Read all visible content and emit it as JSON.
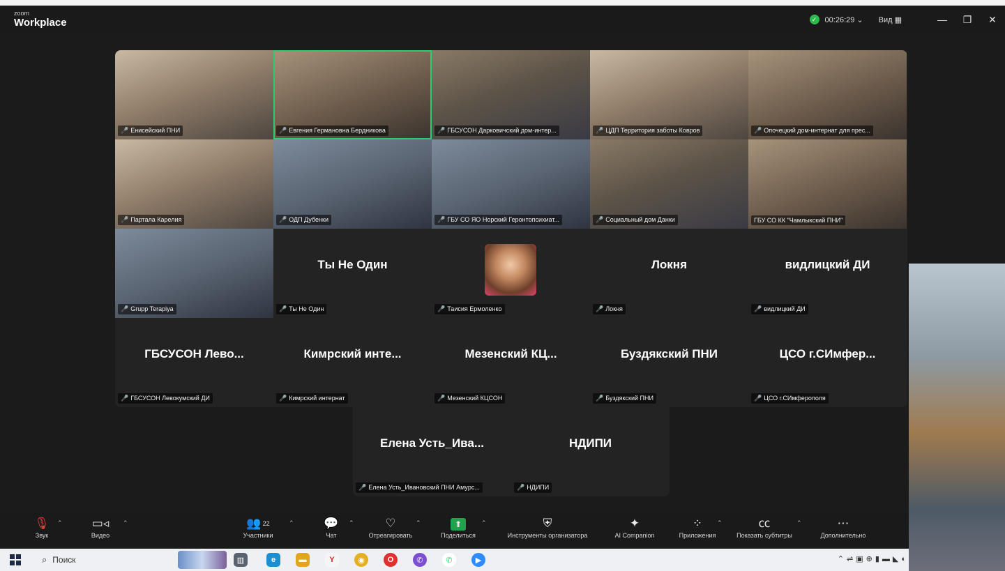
{
  "app": {
    "brand_small": "zoom",
    "brand_big": "Workplace"
  },
  "titlebar": {
    "timer": "00:26:29 ⌄",
    "view_label": "Вид ▦",
    "minimize": "—",
    "restore": "❐",
    "close": "✕"
  },
  "tiles": [
    {
      "label": "Енисейский ПНИ",
      "kind": "video"
    },
    {
      "label": "Евгения Германовна Бердникова",
      "kind": "video",
      "active": true
    },
    {
      "label": "ГБСУСОН Дарковичский дом-интер...",
      "kind": "video"
    },
    {
      "label": "ЦДП Территория заботы Ковров",
      "kind": "video"
    },
    {
      "label": "Опочецкий дом-интернат для прес...",
      "kind": "video"
    },
    {
      "label": "Партала Карелия",
      "kind": "video"
    },
    {
      "label": "ОДП Дубенки",
      "kind": "video"
    },
    {
      "label": "ГБУ СО ЯО Норский Геронтопсихиат...",
      "kind": "video"
    },
    {
      "label": "Социальный дом Данки",
      "kind": "video"
    },
    {
      "label": "ГБУ СО КК \"Чамлыкский ПНИ\"",
      "kind": "video"
    },
    {
      "label": "Grupp Terapiya",
      "kind": "video"
    },
    {
      "label": "Ты Не Один",
      "name": "Ты Не Один",
      "kind": "name"
    },
    {
      "label": "Таисия Ермоленко",
      "kind": "avatar"
    },
    {
      "label": "Локня",
      "name": "Локня",
      "kind": "name"
    },
    {
      "label": "видлицкий ДИ",
      "name": "видлицкий ДИ",
      "kind": "name"
    },
    {
      "label": "ГБСУСОН Левокумский ДИ",
      "name": "ГБСУСОН  Лево...",
      "kind": "name"
    },
    {
      "label": "Кимрский интернат",
      "name": "Кимрский  инте...",
      "kind": "name"
    },
    {
      "label": "Мезенский КЦСОН",
      "name": "Мезенский  КЦ...",
      "kind": "name"
    },
    {
      "label": "Буздякский ПНИ",
      "name": "Буздякский ПНИ",
      "kind": "name"
    },
    {
      "label": "ЦСО г.СИмферополя",
      "name": "ЦСО  г.СИмфер...",
      "kind": "name"
    },
    {
      "label": "Елена Усть_Ивановский ПНИ Амурс...",
      "name": "Елена  Усть_Ива...",
      "kind": "name"
    },
    {
      "label": "НДИПИ",
      "name": "НДИПИ",
      "kind": "name"
    }
  ],
  "toolbar": {
    "audio": "Звук",
    "video": "Видео",
    "participants": "Участники",
    "participants_count": "22",
    "chat": "Чат",
    "react": "Отреагировать",
    "share": "Поделиться",
    "host_tools": "Инструменты организатора",
    "ai_companion": "AI Companion",
    "apps": "Приложения",
    "captions": "Показать субтитры",
    "more": "Дополнительно"
  },
  "taskbar": {
    "search_label": "Поиск"
  },
  "colors": {
    "active_border": "#2ecc71",
    "muted_mic": "#e8413a",
    "share_green": "#23a24d",
    "background": "#1b1b1b"
  }
}
